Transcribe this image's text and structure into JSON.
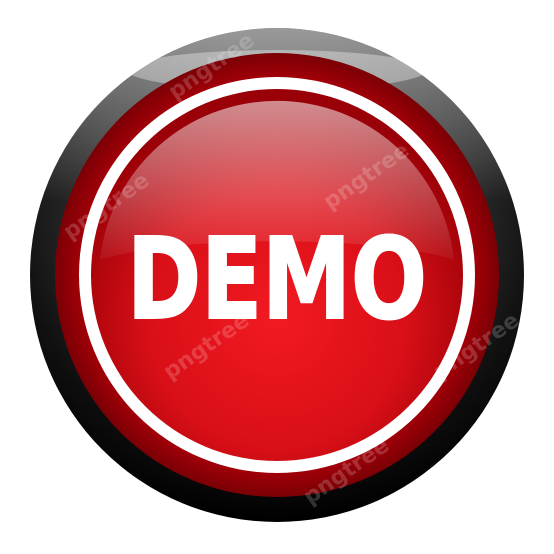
{
  "button": {
    "label": "DEMO",
    "colors": {
      "face_red": "#e0141c",
      "face_red_dark": "#a80008",
      "face_red_light": "#ff5a5f",
      "ring_white": "#ffffff",
      "bezel_black": "#111111",
      "text": "#ffffff"
    }
  },
  "watermark": {
    "text": "pngtree"
  }
}
